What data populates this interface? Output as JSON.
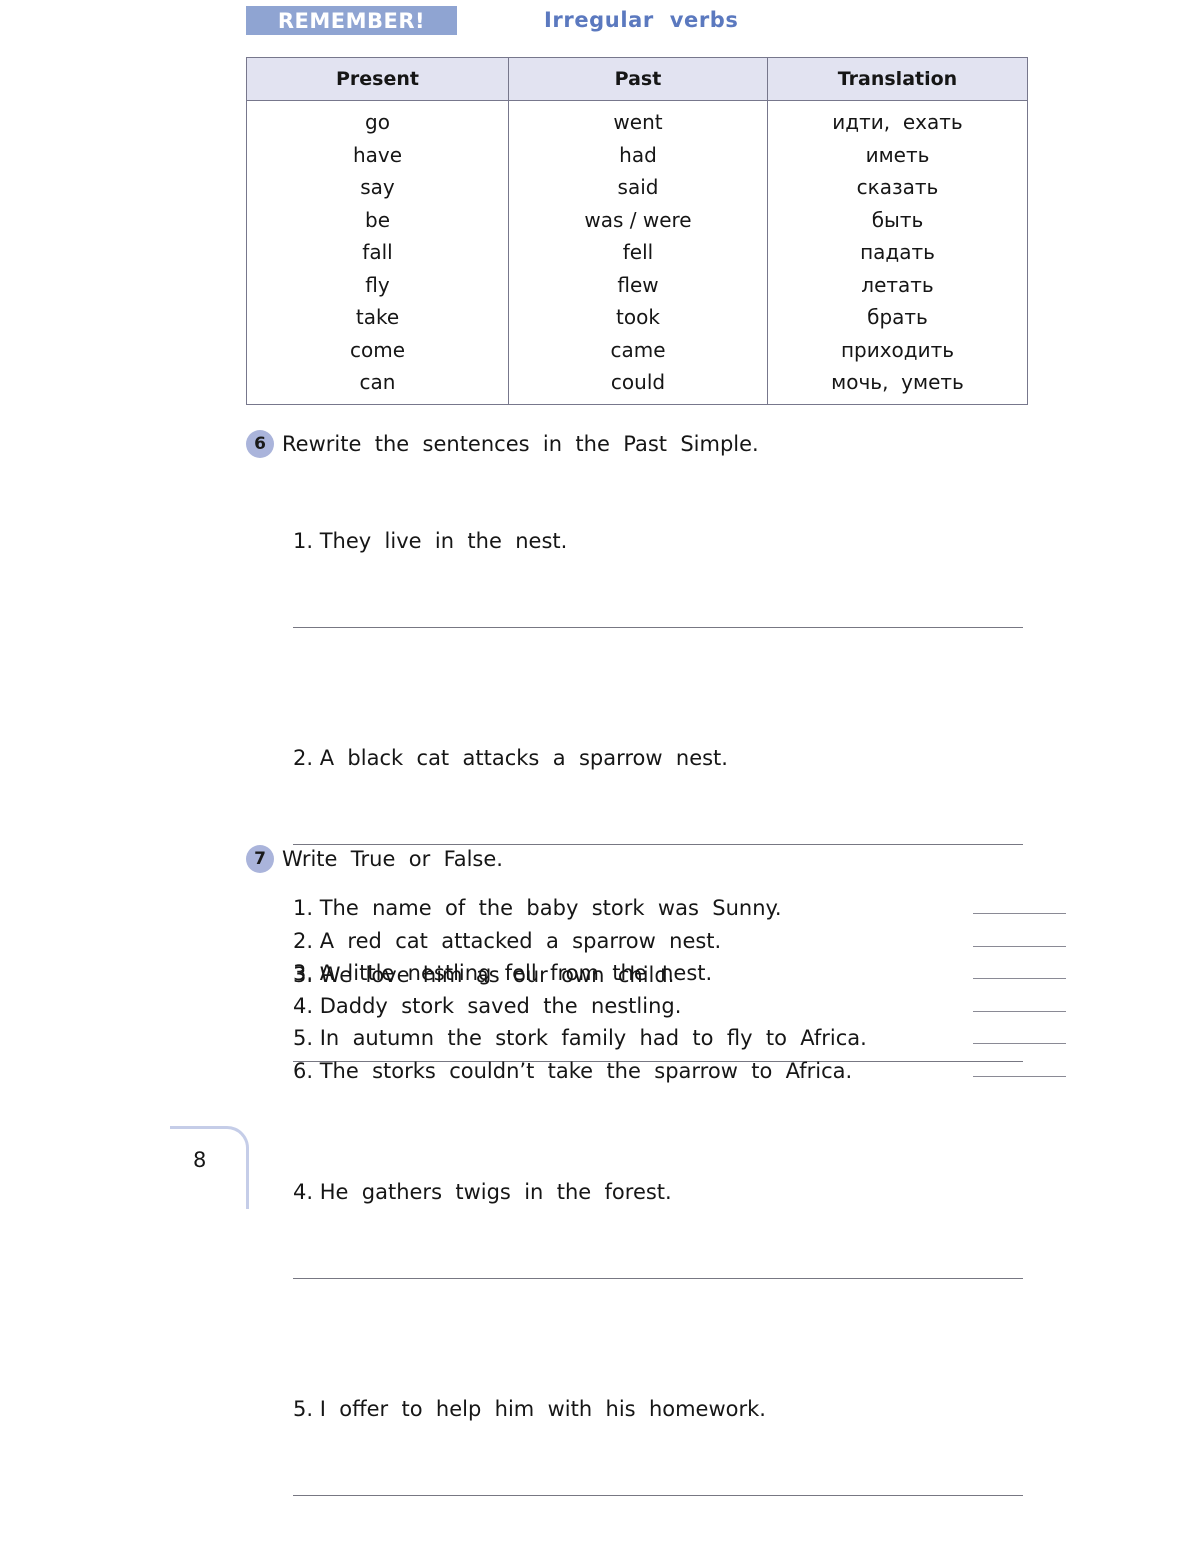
{
  "header": {
    "badge_label": "REMEMBER!",
    "section_title": "Irregular  verbs"
  },
  "colors": {
    "badge_bg": "#8fa4d2",
    "title_blue": "#5b79bf",
    "table_header_bg": "#e2e3f1",
    "exercise_circle": "#aab4db",
    "corner_line": "#c5cde8"
  },
  "verbs_table": {
    "columns": [
      "Present",
      "Past",
      "Translation"
    ],
    "rows": [
      [
        "go",
        "went",
        "идти,  ехать"
      ],
      [
        "have",
        "had",
        "иметь"
      ],
      [
        "say",
        "said",
        "сказать"
      ],
      [
        "be",
        "was / were",
        "быть"
      ],
      [
        "fall",
        "fell",
        "падать"
      ],
      [
        "fly",
        "flew",
        "летать"
      ],
      [
        "take",
        "took",
        "брать"
      ],
      [
        "come",
        "came",
        "приходить"
      ],
      [
        "can",
        "could",
        "мочь,  уметь"
      ]
    ]
  },
  "exercise6": {
    "number": "6",
    "instruction": "Rewrite  the  sentences  in  the  Past  Simple.",
    "questions": [
      "1. They  live  in  the  nest.",
      "2. A  black  cat  attacks  a  sparrow  nest.",
      "3. We  love  him  as  our  own  child.",
      "4. He  gathers  twigs  in  the  forest.",
      "5. I  offer  to  help  him  with  his  homework."
    ]
  },
  "exercise7": {
    "number": "7",
    "instruction": "Write  True  or  False.",
    "questions": [
      "1. The  name  of  the  baby  stork  was  Sunny.",
      "2. A  red  cat  attacked  a  sparrow  nest.",
      "3. A  little  nestling  fell  from  the  nest.",
      "4. Daddy  stork  saved  the  nestling.",
      "5. In  autumn  the  stork  family  had  to  fly  to  Africa.",
      "6. The  storks  couldn’t  take  the  sparrow  to  Africa."
    ]
  },
  "footer": {
    "page_number": "8"
  }
}
